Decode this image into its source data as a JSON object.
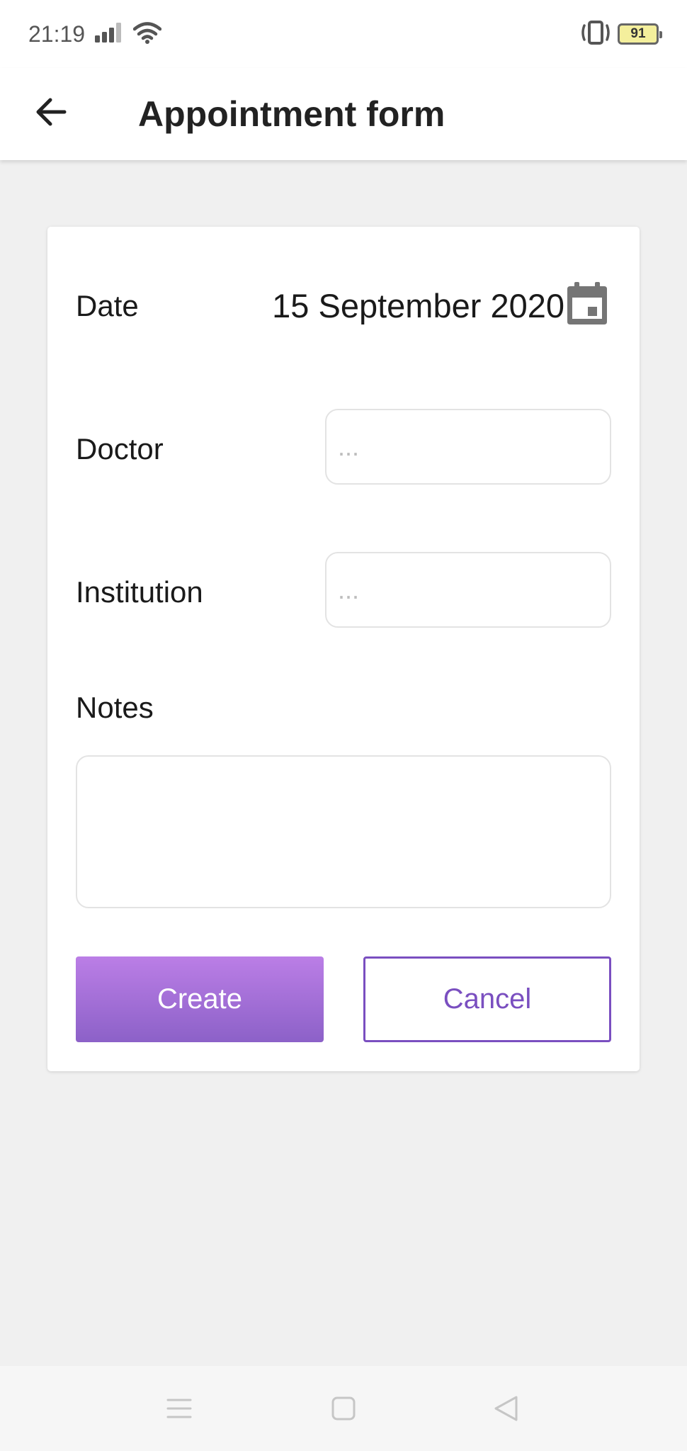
{
  "status_bar": {
    "time": "21:19",
    "battery_level": "91",
    "icons": [
      "signal-icon",
      "wifi-icon",
      "vibrate-icon",
      "battery-icon"
    ]
  },
  "app_bar": {
    "title": "Appointment form",
    "back_icon": "arrow-left-icon"
  },
  "form": {
    "date_label": "Date",
    "date_value": "15 September 2020",
    "calendar_icon": "calendar-icon",
    "doctor_label": "Doctor",
    "doctor_value": "",
    "doctor_placeholder": "...",
    "institution_label": "Institution",
    "institution_value": "",
    "institution_placeholder": "...",
    "notes_label": "Notes",
    "notes_value": "",
    "create_label": "Create",
    "cancel_label": "Cancel"
  },
  "nav_bar": {
    "icons": [
      "menu-icon",
      "home-icon",
      "back-icon"
    ]
  },
  "colors": {
    "accent": "#7a4fc0",
    "create_gradient_top": "#bb7ee6",
    "create_gradient_bottom": "#8c61c8",
    "background": "#f0f0f0"
  }
}
